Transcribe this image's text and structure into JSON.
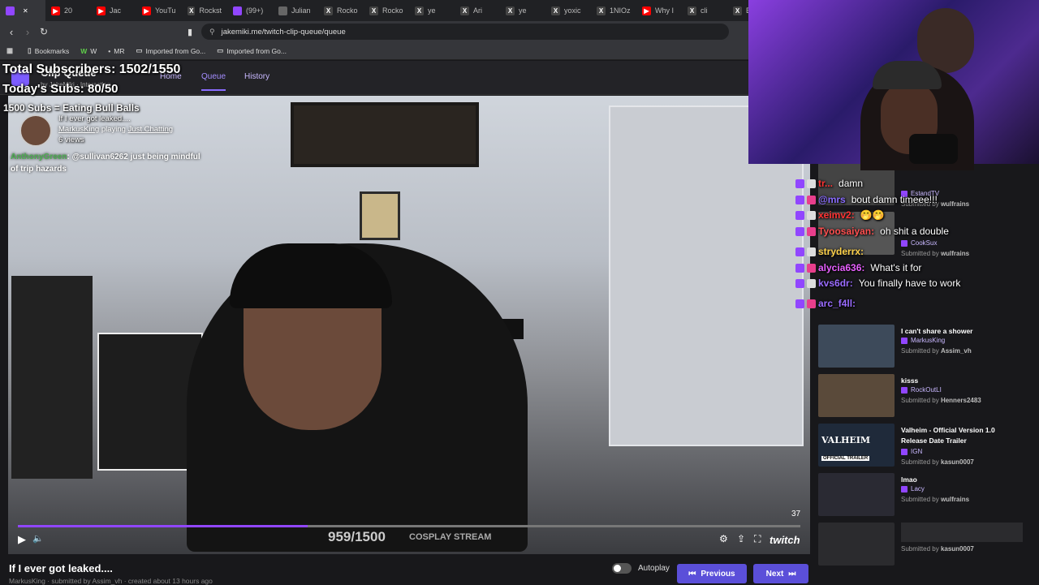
{
  "browser": {
    "tabs": [
      {
        "icon": "twitch-icon",
        "color": "#9146ff",
        "label": ""
      },
      {
        "icon": "youtube-icon",
        "color": "#ff0000",
        "label": "20"
      },
      {
        "icon": "youtube-icon",
        "color": "#ff0000",
        "label": "Jac"
      },
      {
        "icon": "youtube-icon",
        "color": "#ff0000",
        "label": "YouTu"
      },
      {
        "icon": "x-icon",
        "color": "#444",
        "label": "Rockst"
      },
      {
        "icon": "twitch-icon",
        "color": "#9146ff",
        "label": "(99+)"
      },
      {
        "icon": "site-icon",
        "color": "#666",
        "label": "Julian"
      },
      {
        "icon": "x-icon",
        "color": "#444",
        "label": "Rocko"
      },
      {
        "icon": "x-icon",
        "color": "#444",
        "label": "Rocko"
      },
      {
        "icon": "x-icon",
        "color": "#444",
        "label": "ye"
      },
      {
        "icon": "x-icon",
        "color": "#444",
        "label": "Ari"
      },
      {
        "icon": "x-icon",
        "color": "#444",
        "label": "ye"
      },
      {
        "icon": "x-icon",
        "color": "#444",
        "label": "yoxic"
      },
      {
        "icon": "x-icon",
        "color": "#444",
        "label": "1NIOz"
      },
      {
        "icon": "youtube-icon",
        "color": "#ff0000",
        "label": "Why I"
      },
      {
        "icon": "x-icon",
        "color": "#444",
        "label": "cli"
      },
      {
        "icon": "x-icon",
        "color": "#444",
        "label": "B"
      }
    ],
    "url": "jakemiki.me/twitch-clip-queue/queue",
    "bookmarks": [
      {
        "icon": "grid-icon",
        "label": ""
      },
      {
        "icon": "bookmark-icon",
        "label": "Bookmarks"
      },
      {
        "icon": "w-icon",
        "label": "W"
      },
      {
        "icon": "dot-icon",
        "label": "MR"
      },
      {
        "icon": "folder-icon",
        "label": "Imported from Go..."
      },
      {
        "icon": "folder-icon",
        "label": "Imported from Go..."
      }
    ]
  },
  "site": {
    "name": "Clip Queue",
    "sub": "by JakeMiki  ·  Interacting",
    "nav": {
      "home": "Home",
      "queue": "Queue",
      "history": "History"
    }
  },
  "overlay": {
    "total_subs": "Total Subscribers: 1502/1550",
    "today_subs": "Today's Subs: 80/50",
    "goal": "1500 Subs = Eating Bull Balls"
  },
  "clip": {
    "title": "If I ever got leaked....",
    "channel": "MarkusKing",
    "playing_word": "playing",
    "game": "Just Chatting",
    "views": "6 views",
    "chat_text": "@sullivan6262 just being mindful of trip hazards",
    "chat_user": "AnthonyGreen",
    "meta": "MarkusKing · submitted by Assim_vh · created about 13 hours ago",
    "progress": 0.37,
    "counter": "37",
    "sub_goal": "959/1500",
    "sub_goal_label": "COSPLAY STREAM",
    "twitch_mark": "twitch"
  },
  "controls": {
    "autoplay": "Autoplay",
    "previous": "Previous",
    "next": "Next"
  },
  "chat": [
    {
      "user": "tr...",
      "color": "#ff3333",
      "msg": "damn"
    },
    {
      "user": "@mrs",
      "color": "#8a6cff",
      "msg": "bout damn timeee!!!"
    },
    {
      "user": "xeimv2:",
      "color": "#ff3333",
      "msg": "🤭🤭"
    },
    {
      "user": "Tyoosaiyan:",
      "color": "#ff4f4f",
      "msg": "oh shit a double"
    },
    {
      "user": "stryderrx:",
      "color": "#ffd24a",
      "msg": ""
    },
    {
      "user": "alycia636:",
      "color": "#e860ff",
      "msg": "What's it for"
    },
    {
      "user": "kvs6dr:",
      "color": "#9a6cff",
      "msg": "You finally have to work"
    },
    {
      "user": "arc_f4ll:",
      "color": "#9a6cff",
      "msg": ""
    }
  ],
  "queue": [
    {
      "title": "",
      "channel": "EstandTV",
      "submitter": "wulfrains",
      "thumb": "#444"
    },
    {
      "title": "",
      "channel": "CookSux",
      "submitter": "wulfrains",
      "thumb": "#555"
    },
    {
      "title": "I can't share a shower",
      "channel": "MarkusKing",
      "submitter": "Assim_vh",
      "thumb": "#3d4a5a"
    },
    {
      "title": "kisss",
      "channel": "RockOutLI",
      "submitter": "Henners2483",
      "thumb": "#5a4a3a"
    },
    {
      "title": "Valheim - Official Version 1.0 Release Date Trailer",
      "channel": "IGN",
      "submitter": "kasun0007",
      "thumb": "#1f2a3a",
      "badge": "VALHEIM",
      "badge2": "OFFICIAL TRAILER"
    },
    {
      "title": "lmao",
      "channel": "Lacy",
      "submitter": "wulfrains",
      "thumb": "#2a2a33"
    },
    {
      "title": "",
      "channel": "",
      "submitter": "kasun0007",
      "thumb": "#2b2b2e"
    }
  ],
  "submitted_by": "Submitted by"
}
